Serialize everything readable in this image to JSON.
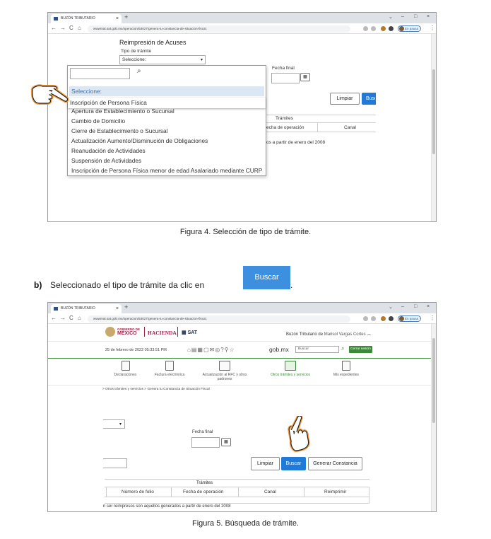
{
  "browser": {
    "tab_title": "BUZÓN TRIBUTARIO",
    "tab_close": "×",
    "new_tab": "+",
    "win_controls": [
      "⌄",
      "–",
      "□",
      "×"
    ],
    "nav_back": "←",
    "nav_forward": "→",
    "nav_reload": "C",
    "nav_home": "⌂",
    "url": "wwwmat.sat.gob.mx/operacion/53027/genera-tu-constancia-de-situacion-fiscal.",
    "url2": "wwwmat.sat.gob.mx/operacion/53027/genera-tu-constancia-de-situacion-fiscal.",
    "paused_label": "En pausa",
    "menu_dots": "⋮"
  },
  "figure4": {
    "heading": "Reimpresión de Acuses",
    "tipo_label": "Tipo de trámite",
    "select_value": "Seleccione:",
    "search_icon_glyph": "⌕",
    "fecha_final_label": "Fecha final",
    "cal_glyph": "▦",
    "limpiar_label": "Limpiar",
    "buscar_label": "Busc",
    "tramites_label": "Trámites",
    "col_fecha": "echa de operación",
    "col_canal": "Canal",
    "footnote": "os a partir de enero del 2008",
    "options": [
      "Seleccione:",
      "Inscripción de Persona Física",
      "Apertura de Establecimiento o Sucursal",
      "Cambio de Domicilio",
      "Cierre de Establecimiento o Sucursal",
      "Actualización Aumento/Disminución de Obligaciones",
      "Reanudación de Actividades",
      "Suspensión de Actividades",
      "Inscripción de Persona Física menor de edad Asalariado mediante CURP"
    ],
    "caption": "Figura 4. Selección de tipo de trámite."
  },
  "step_b": {
    "marker": "b)",
    "text": "Seleccionado el tipo de trámite da clic en",
    "button_label": "Buscar",
    "period": "."
  },
  "figure5": {
    "gob_line1": "GOBIERNO DE",
    "gob_line2": "MÉXICO",
    "hacienda": "HACIENDA",
    "sat": "SAT",
    "buzon_label": "Buzón Tributario de",
    "user_name": "Marisol Vargas Cortes",
    "chevron": "︿",
    "date": "25 de febrero de 2022 05:33:51 PM",
    "gob_mx": "gob.mx",
    "search_placeholder": "Buscar",
    "cerrar_sesion": "Cerrar sesión",
    "nav": [
      {
        "label": "Declaraciones"
      },
      {
        "label": "Factura electrónica"
      },
      {
        "label": "Actualización al RFC y otros padrones"
      },
      {
        "label": "Otros trámites y servicios"
      },
      {
        "label": "Mis expedientes"
      }
    ],
    "breadcrumb": "> Otros trámites y servicios > Genera tu Constancia de Situación Fiscal",
    "fecha_final_label": "Fecha final",
    "cal_glyph": "▦",
    "select_arrow": "▾",
    "limpiar_label": "Limpiar",
    "buscar_label": "Buscar",
    "generar_label": "Generar Constancia",
    "tramites_label": "Trámites",
    "columns": [
      "Número de folio",
      "Fecha de operación",
      "Canal",
      "Reimprimir"
    ],
    "footnote": "n ser reimpresos son aquellos generados a partir de enero del 2008",
    "caption": "Figura 5. Búsqueda de trámite."
  },
  "colors": {
    "primary_blue": "#1f7ad8",
    "highlight": "#dbe8f3",
    "sat_green": "#3a8a3a",
    "gob_red": "#9d2449"
  }
}
